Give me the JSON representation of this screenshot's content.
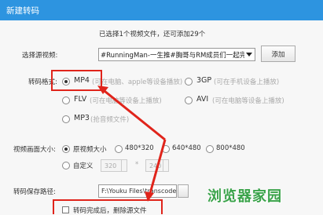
{
  "window": {
    "title": "新建转码"
  },
  "source": {
    "status": "已选择1个视频文件，还可添加29个",
    "label": "选择源视频:",
    "selected": "#RunningMan-一生推#胸哥与RM成员们一起完成的-RM之歌",
    "add_label": "添加"
  },
  "format": {
    "label": "转码格式:",
    "options": [
      {
        "name": "MP4",
        "hint": "(可在电脑、apple等设备播放)",
        "selected": true
      },
      {
        "name": "3GP",
        "hint": "(可在手机设备上播放)",
        "selected": false
      },
      {
        "name": "FLV",
        "hint": "(可在电脑等设备上播放)",
        "selected": false
      },
      {
        "name": "AVI",
        "hint": "(可在电脑等设备上播放)",
        "selected": false
      },
      {
        "name": "MP3",
        "hint": "(抢音频文件)",
        "selected": false
      }
    ]
  },
  "size": {
    "label": "视频画面大小:",
    "options": [
      "原视频大小",
      "480*320",
      "640*480",
      "800*480"
    ],
    "selected": "原视频大小",
    "custom_label": "自定义",
    "width": "320",
    "sep": "*",
    "height": "240"
  },
  "save": {
    "label": "转码保存路径:",
    "path": "F:\\Youku Files\\transcode",
    "after_label": "转码完成后，删除源文件"
  },
  "watermark": "浏览器家园",
  "colors": {
    "title_bar": "#2d94e0",
    "annotation": "#e0241b",
    "watermark": "#3aa34a"
  }
}
